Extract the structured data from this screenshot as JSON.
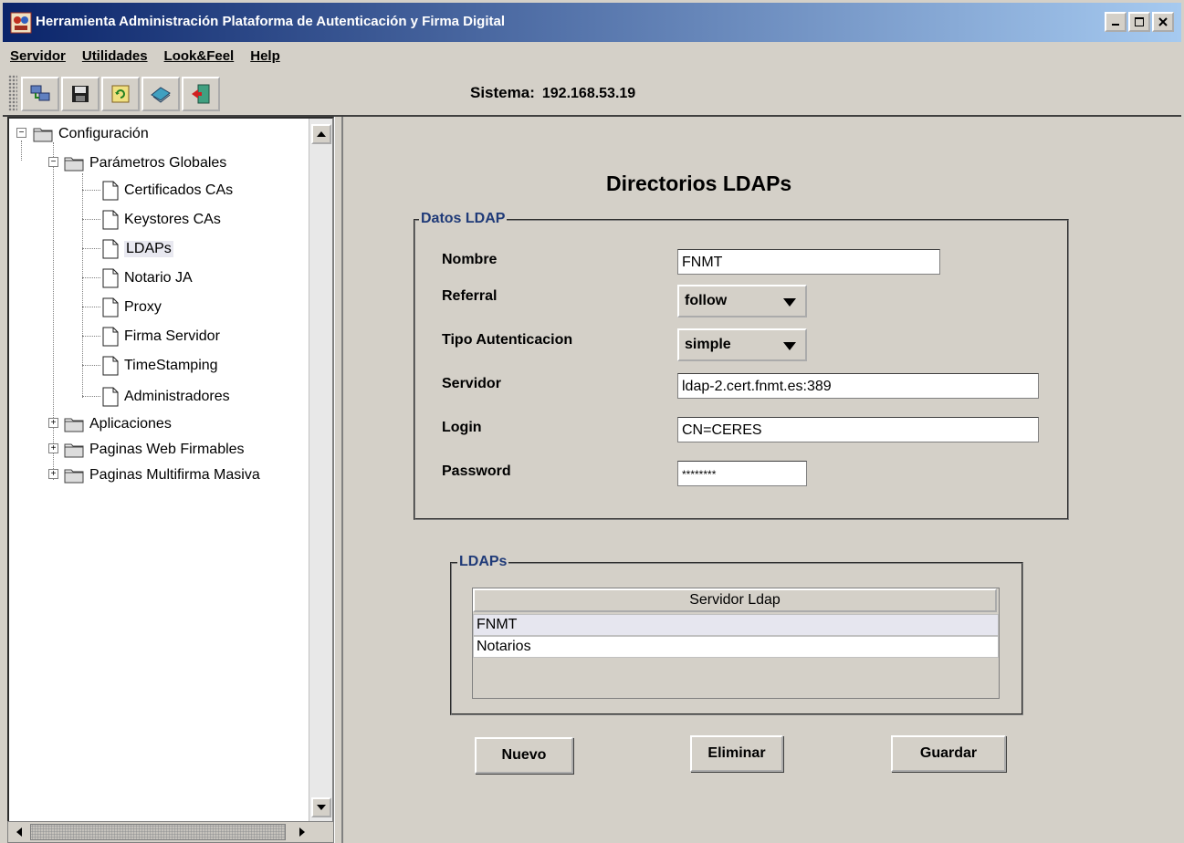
{
  "window": {
    "title": "Herramienta Administración Plataforma de Autenticación y Firma Digital"
  },
  "menu": [
    "Servidor",
    "Utilidades",
    "Look&Feel",
    "Help"
  ],
  "toolbar": {
    "icons": [
      "network-icon",
      "save-icon",
      "refresh-icon",
      "book-icon",
      "exit-icon"
    ],
    "sistema_label": "Sistema:",
    "sistema_value": "192.168.53.19"
  },
  "tree": {
    "root": "Configuración",
    "globales": "Parámetros Globales",
    "items": [
      "Certificados CAs",
      "Keystores CAs",
      "LDAPs",
      "Notario JA",
      "Proxy",
      "Firma Servidor",
      "TimeStamping",
      "Administradores"
    ],
    "selected": "LDAPs",
    "aplicaciones": "Aplicaciones",
    "web_firmables": "Paginas Web Firmables",
    "multifirma": "Paginas Multifirma Masiva"
  },
  "main": {
    "heading": "Directorios LDAPs",
    "datos_legend": "Datos LDAP",
    "fields": {
      "nombre_label": "Nombre",
      "nombre_value": "FNMT",
      "referral_label": "Referral",
      "referral_value": "follow",
      "tipo_label": "Tipo Autenticacion",
      "tipo_value": "simple",
      "servidor_label": "Servidor",
      "servidor_value": "ldap-2.cert.fnmt.es:389",
      "login_label": "Login",
      "login_value": "CN=CERES",
      "password_label": "Password",
      "password_value": "********"
    },
    "ldaps_legend": "LDAPs",
    "table": {
      "header": "Servidor Ldap",
      "rows": [
        "FNMT",
        "Notarios"
      ]
    },
    "buttons": {
      "nuevo": "Nuevo",
      "eliminar": "Eliminar",
      "guardar": "Guardar"
    }
  },
  "colors": {
    "title_start": "#0a246a",
    "title_end": "#a6caf0",
    "legend": "#1f3a78",
    "face": "#d4d0c8"
  }
}
